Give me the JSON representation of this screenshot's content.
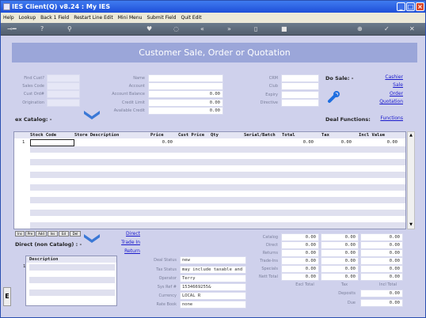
{
  "window": {
    "title": "IES Client(Q) v8.24 : My IES"
  },
  "menu": [
    "Help",
    "Lookup",
    "Back 1 Field",
    "Restart Line Edit",
    "Mini Menu",
    "Submit Field",
    "Quit Edit"
  ],
  "header": {
    "title": "Customer Sale, Order or Quotation"
  },
  "customer": {
    "find_cust_label": "Find Cust?",
    "sales_code_label": "Sales Code",
    "cust_ord_label": "Cust Ord#",
    "origination_label": "Origination",
    "name_label": "Name",
    "account_label": "Account",
    "account_balance_label": "Account Balance",
    "account_balance": "0.00",
    "credit_limit_label": "Credit Limit",
    "credit_limit": "0.00",
    "available_credit_label": "Available Credit",
    "available_credit": "0.00",
    "crm_label": "CRM",
    "club_label": "Club",
    "expiry_label": "Expiry",
    "directive_label": "Directive"
  },
  "do_sale": {
    "label": "Do Sale: -",
    "links": [
      "Cashier",
      "Sale",
      "Order",
      "Quotation"
    ]
  },
  "catalog": {
    "label": "ex Catalog: -"
  },
  "deal": {
    "label": "Deal Functions:",
    "link": "Functions"
  },
  "grid": {
    "columns": [
      "Stock Code",
      "Store Description",
      "Price",
      "Cust Price",
      "Qty",
      "Serial/Batch",
      "Total",
      "Tax",
      "Incl Value"
    ],
    "row_number": "1",
    "price": "0.00",
    "total": "0.00",
    "tax": "0.00",
    "incl_value": "0.00"
  },
  "row_buttons": [
    "Ins",
    "Pre",
    "Add",
    "Ins",
    "Ed",
    "Del"
  ],
  "direct": {
    "label": "Direct (non Catalog) : -",
    "links": [
      "Direct",
      "Trade In",
      "Return"
    ]
  },
  "desc_grid": {
    "column": "Description",
    "row_number": "1"
  },
  "status": {
    "deal_status_label": "Deal Status",
    "deal_status": "new",
    "tax_status_label": "Tax Status",
    "tax_status": "may include taxable and",
    "operator_label": "Operator",
    "operator": "Terry",
    "sys_ref_label": "Sys Ref #",
    "sys_ref": "1534669255&",
    "currency_label": "Currency",
    "currency": "LOCAL R",
    "rate_book_label": "Rate Book",
    "rate_book": "none"
  },
  "totals": {
    "rows": [
      {
        "label": "Catalog",
        "excl": "0.00",
        "tax": "0.00",
        "incl": "0.00"
      },
      {
        "label": "Direct",
        "excl": "0.00",
        "tax": "0.00",
        "incl": "0.00"
      },
      {
        "label": "Returns",
        "excl": "0.00",
        "tax": "0.00",
        "incl": "0.00"
      },
      {
        "label": "Trade-Ins",
        "excl": "0.00",
        "tax": "0.00",
        "incl": "0.00"
      },
      {
        "label": "Specials",
        "excl": "0.00",
        "tax": "0.00",
        "incl": "0.00"
      },
      {
        "label": "Nett Total",
        "excl": "0.00",
        "tax": "0.00",
        "incl": "0.00"
      }
    ],
    "excl_label": "Excl Total",
    "tax_label": "Tax",
    "incl_label": "Incl Total",
    "deposits_label": "Deposits",
    "deposits": "0.00",
    "due_label": "Due",
    "due": "0.00"
  },
  "colors": {
    "accent": "#9ba6d9",
    "title": "#1f4fd8",
    "link": "#1a1acc"
  }
}
